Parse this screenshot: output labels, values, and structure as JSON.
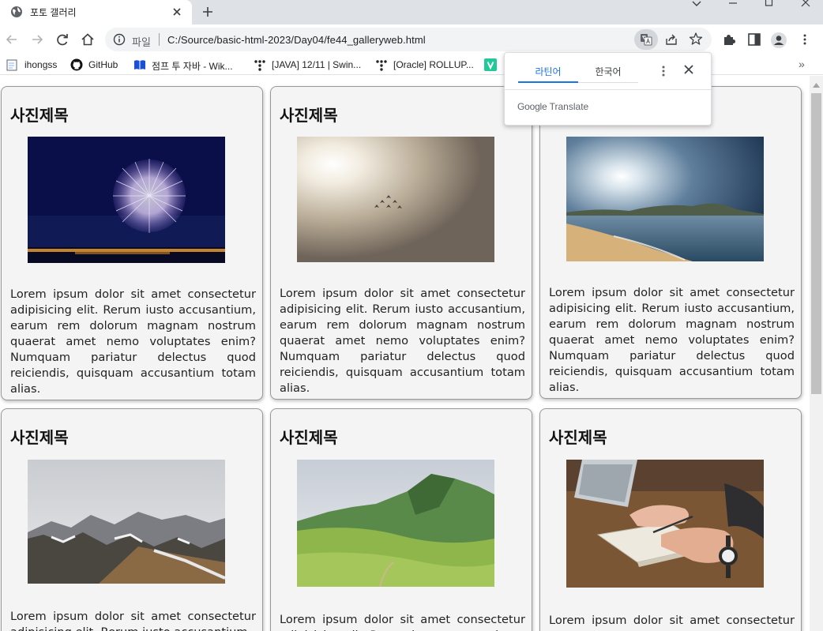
{
  "browser": {
    "tab_title": "포토 갤러리",
    "address": {
      "scheme_label": "파일",
      "url": "C:/Source/basic-html-2023/Day04/fe44_galleryweb.html"
    },
    "bookmarks": [
      {
        "label": "ihongss",
        "icon": "page-icon"
      },
      {
        "label": "GitHub",
        "icon": "github-icon"
      },
      {
        "label": "점프 투 자바 - Wik...",
        "icon": "book-icon"
      },
      {
        "label": "[JAVA] 12/11 | Swin...",
        "icon": "tistory-icon"
      },
      {
        "label": "[Oracle] ROLLUP...",
        "icon": "tistory-icon"
      },
      {
        "label": "",
        "icon": "v-icon"
      }
    ],
    "bookmarks_overflow": "»"
  },
  "translate_popup": {
    "source_lang": "라틴어",
    "target_lang": "한국어",
    "brand_google": "Google",
    "brand_translate": "Translate"
  },
  "gallery": {
    "cards": [
      {
        "title": "사진제목",
        "image": "fireworks",
        "text": "Lorem ipsum dolor sit amet consectetur adipisicing elit. Rerum iusto accusantium, earum rem dolorum magnam nostrum quaerat amet nemo voluptates enim? Numquam pariatur delectus quod reiciendis, quisquam accusantium totam alias."
      },
      {
        "title": "사진제목",
        "image": "jets-in-haze",
        "text": "Lorem ipsum dolor sit amet consectetur adipisicing elit. Rerum iusto accusantium, earum rem dolorum magnam nostrum quaerat amet nemo voluptates enim? Numquam pariatur delectus quod reiciendis, quisquam accusantium totam alias."
      },
      {
        "title": "",
        "image": "beach-sunset",
        "text": "Lorem ipsum dolor sit amet consectetur adipisicing elit. Rerum iusto accusantium, earum rem dolorum magnam nostrum quaerat amet nemo voluptates enim? Numquam pariatur delectus quod reiciendis, quisquam accusantium totam alias."
      },
      {
        "title": "사진제목",
        "image": "snowy-mountains",
        "text": "Lorem ipsum dolor sit amet consectetur adipisicing elit. Rerum iusto accusantium,"
      },
      {
        "title": "사진제목",
        "image": "green-hills",
        "text": "Lorem ipsum dolor sit amet consectetur adipisicing elit. Rerum iusto accusantium,"
      },
      {
        "title": "사진제목",
        "image": "laptop-notebook",
        "text": "Lorem ipsum dolor sit amet consectetur adipisicing elit. Rerum iusto accusantium,"
      }
    ]
  },
  "colors": {
    "accent": "#1a73e8",
    "card_bg": "#f4f4f4",
    "card_border": "#999999",
    "tabstrip": "#dee1e6"
  }
}
